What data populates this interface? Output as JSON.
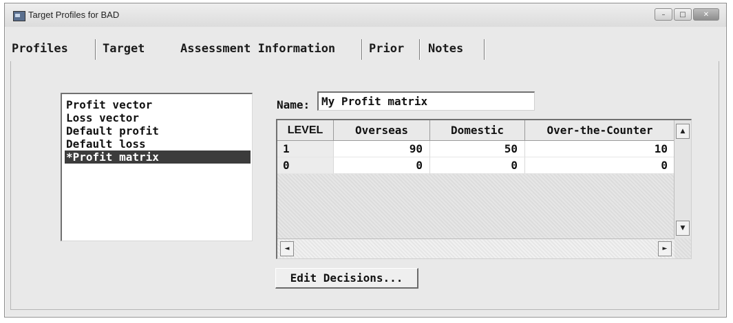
{
  "window": {
    "title": "Target Profiles for BAD",
    "controls": {
      "minimize": "–",
      "maximize": "□",
      "close": "✕"
    }
  },
  "tabs": [
    {
      "label": "Profiles"
    },
    {
      "label": "Target"
    },
    {
      "label": "Assessment Information",
      "active": true
    },
    {
      "label": "Prior"
    },
    {
      "label": "Notes"
    }
  ],
  "matrix_list": {
    "items": [
      {
        "label": "Profit vector"
      },
      {
        "label": "Loss vector"
      },
      {
        "label": "Default profit"
      },
      {
        "label": "Default loss"
      },
      {
        "label": "*Profit matrix",
        "selected": true
      }
    ]
  },
  "name_field": {
    "label": "Name:",
    "value": "My Profit matrix"
  },
  "matrix_grid": {
    "columns": [
      "LEVEL",
      "Overseas",
      "Domestic",
      "Over-the-Counter"
    ],
    "rows": [
      {
        "level": "1",
        "values": [
          "90",
          "50",
          "10"
        ]
      },
      {
        "level": "0",
        "values": [
          "0",
          "0",
          "0"
        ]
      }
    ]
  },
  "scroll_icons": {
    "up": "▲",
    "down": "▼",
    "left": "◄",
    "right": "►"
  },
  "buttons": {
    "edit_decisions": "Edit Decisions..."
  }
}
